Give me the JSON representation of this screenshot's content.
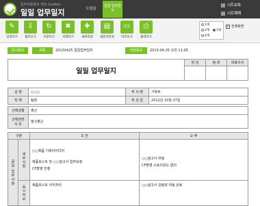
{
  "header": {
    "brand_sub": "업무자동화의 핵심 Godkey",
    "title": "일일 업무일지",
    "tab_help": "도움말",
    "tab_active": "일일 업무일지",
    "btn_sheet_show": "시트보호",
    "btn_sheet_hide": "시트해제"
  },
  "toolbar": {
    "items": [
      {
        "label": "입력하기",
        "glyph": "✎"
      },
      {
        "label": "불러오기",
        "glyph": "⇩"
      },
      {
        "label": "수정하기",
        "glyph": "↻"
      },
      {
        "label": "삭제하기",
        "glyph": "✖"
      },
      {
        "label": "새로작성",
        "glyph": "✚"
      },
      {
        "label": "새문서작성",
        "glyph": "▤"
      },
      {
        "label": "미리보기",
        "glyph": "▭"
      },
      {
        "label": "출력하기",
        "glyph": "⎙"
      }
    ],
    "options": [
      "1개",
      "2개",
      "3개",
      "4개"
    ],
    "selected_option": "3개",
    "checkbox_label": "전체화면"
  },
  "info": {
    "doc_label": "문서정보",
    "title_label": "제목",
    "title_value": "20130425 일일업무일지",
    "saved_label": "저장정보",
    "saved_value": "2013-04-25  오전 11:05"
  },
  "doc": {
    "title": "일일 업무일지",
    "approvals": [
      "담 당",
      "팀 장",
      "대표이사"
    ],
    "name_label": "성    명",
    "name_value": "○○○",
    "dept_label": "부 서 명",
    "dept_value": "기획부",
    "position_label": "직    책",
    "position_value": "팀장",
    "date_label": "작 성 일",
    "date_value": "2012년 10월 27일",
    "attendance_label": "근태상황",
    "attendance_value": "출근",
    "attendance_note_label": "근태관련 사 유",
    "attendance_note_value": "정시출근",
    "section_label": "구분",
    "am_label": "오    전",
    "pm_label": "오    후",
    "work_label": "금일 업무사항",
    "detail_label": "세부사항",
    "result_label": "실시여부",
    "am_detail": [
      "○○제품 기획아이디어",
      "제품포스트 및 ○○광고사 업무요청",
      "CF촬영 진행"
    ],
    "pm_detail": [
      "○○광고사 미팅",
      "CF촬영 스토리보드 협의"
    ],
    "am_result": "제품포스트 이익처리",
    "pm_result": "○○광고사 김팀장 미팅 완료"
  }
}
